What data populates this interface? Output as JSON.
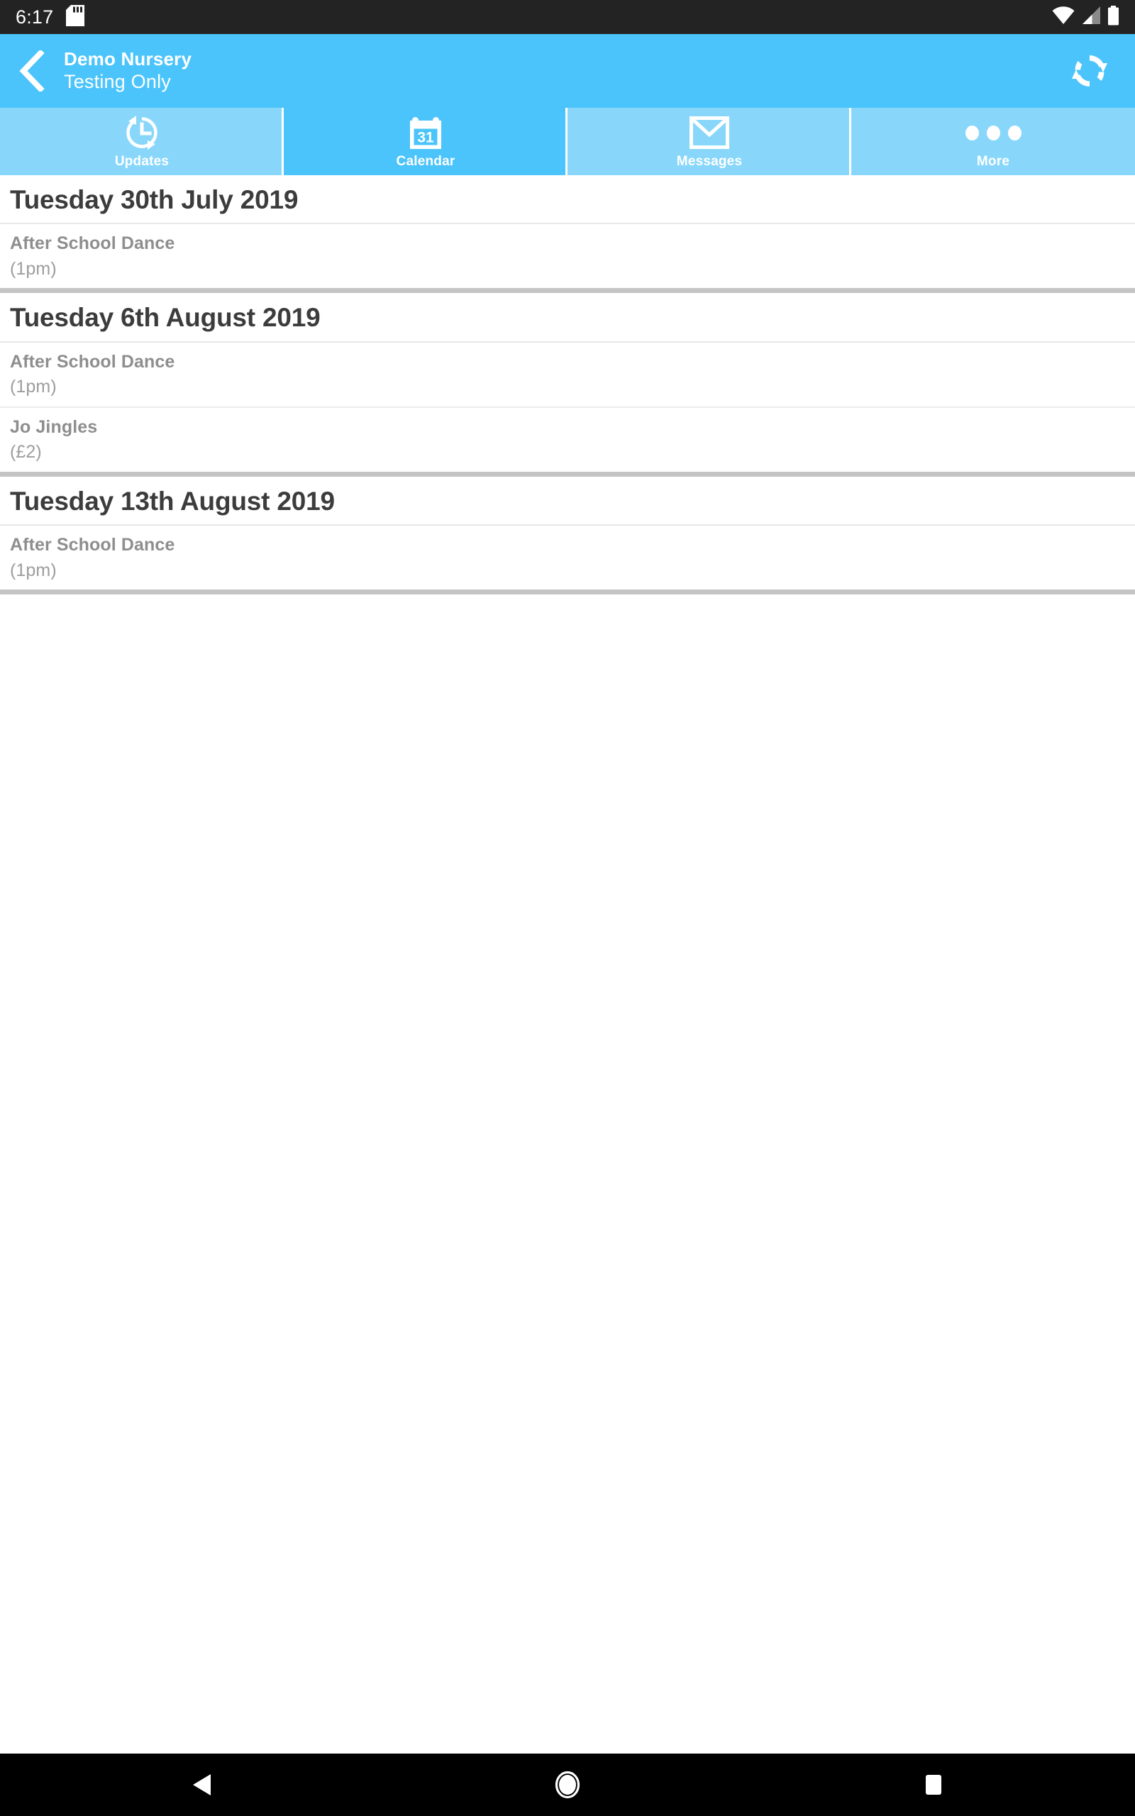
{
  "status_bar": {
    "clock": "6:17",
    "icons": [
      "sd-card-icon",
      "wifi-icon",
      "cellular-signal-icon",
      "battery-icon"
    ]
  },
  "header": {
    "back_icon": "back-chevron-icon",
    "title": "Demo Nursery",
    "subtitle": "Testing Only",
    "refresh_icon": "refresh-sync-icon",
    "background_color": "#4BC4FB"
  },
  "tabs": {
    "active_index": 1,
    "inactive_color": "#88D7FB",
    "active_color": "#4BC4FB",
    "items": [
      {
        "label": "Updates",
        "icon": "history-clock-icon"
      },
      {
        "label": "Calendar",
        "icon": "calendar-31-icon"
      },
      {
        "label": "Messages",
        "icon": "envelope-icon"
      },
      {
        "label": "More",
        "icon": "ellipsis-icon"
      }
    ]
  },
  "calendar": {
    "groups": [
      {
        "date": "Tuesday 30th July 2019",
        "events": [
          {
            "title": "After School Dance",
            "meta": "(1pm)"
          }
        ]
      },
      {
        "date": "Tuesday 6th August 2019",
        "events": [
          {
            "title": "After School Dance",
            "meta": "(1pm)"
          },
          {
            "title": "Jo Jingles",
            "meta": "(£2)"
          }
        ]
      },
      {
        "date": "Tuesday 13th August 2019",
        "events": [
          {
            "title": "After School Dance",
            "meta": "(1pm)"
          }
        ]
      }
    ]
  },
  "nav_bar": {
    "back": "back-triangle-icon",
    "home": "home-circle-icon",
    "recents": "recents-square-icon"
  }
}
